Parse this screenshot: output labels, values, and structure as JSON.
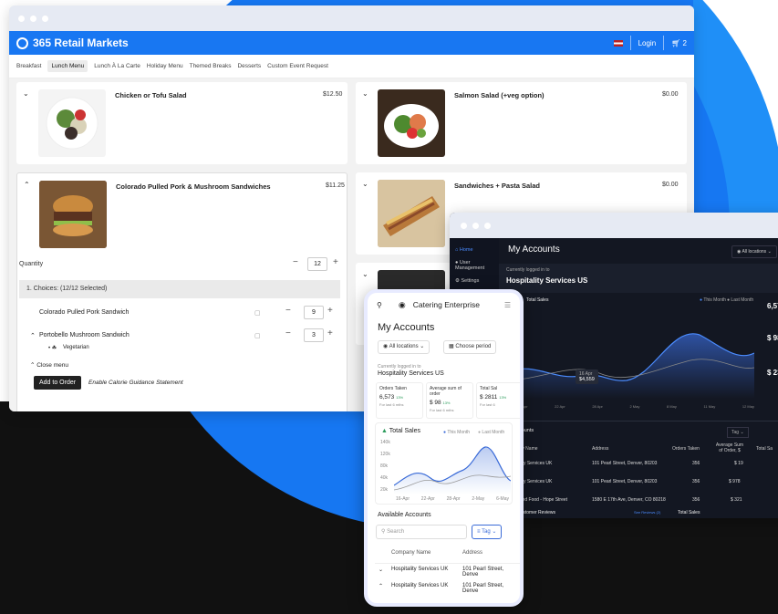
{
  "retail": {
    "brand": "365 Retail Markets",
    "login": "Login",
    "cart_count": "2",
    "categories": [
      "Breakfast",
      "Lunch Menu",
      "Lunch À La Carte",
      "Holiday Menu",
      "Themed Breaks",
      "Desserts",
      "Custom Event Request"
    ],
    "active_category": "Lunch Menu",
    "items": [
      {
        "name": "Chicken or Tofu Salad",
        "price": "$12.50"
      },
      {
        "name": "Salmon Salad (+veg option)",
        "price": "$0.00"
      },
      {
        "name": "Colorado Pulled Pork & Mushroom Sandwiches",
        "price": "$11.25"
      },
      {
        "name": "Sandwiches + Pasta Salad",
        "price": "$0.00"
      }
    ],
    "quantity_label": "Quantity",
    "quantity_value": "12",
    "choices_header": "1. Choices:  (12/12 Selected)",
    "choices": [
      {
        "name": "Colorado Pulled Pork Sandwich",
        "qty": "9"
      },
      {
        "name": "Portobello Mushroom Sandwich",
        "qty": "3"
      }
    ],
    "vegetarian": "Vegetarian",
    "close_menu": "Close menu",
    "add_to_order": "Add to Order",
    "calorie": "Enable Calorie Guidance Statement"
  },
  "dashboard": {
    "title": "My Accounts",
    "nav": [
      "Home",
      "User Management",
      "Settings"
    ],
    "locations": "All locations",
    "logged_in_label": "Currently logged in to",
    "account": "Hospitality Services US",
    "total_sales": "Total Sales",
    "legend": [
      "This Month",
      "Last Month"
    ],
    "tooltip_date": "16 Apr",
    "tooltip_value": "$4,559",
    "x_ticks": [
      "16 Apr",
      "22 Apr",
      "28 Apr",
      "2 May",
      "8 May",
      "11 May",
      "12 May"
    ],
    "side_values": [
      "6,57",
      "$ 98",
      "$ 23"
    ],
    "accounts_title": "le Accounts",
    "tag": "Tag",
    "columns": [
      "ompany Name",
      "Address",
      "Orders Taken",
      "Average Sum of Order, $",
      "Total Sa"
    ],
    "rows": [
      {
        "name": "ospitality Services UK",
        "address": "101 Pearl Street, Denver, 80203",
        "orders": "356",
        "avg": "$ 19"
      },
      {
        "name": "ospitality Services UK",
        "address": "101 Pearl Street, Denver, 80203",
        "orders": "356",
        "avg": "$ 978"
      },
      {
        "name": "ssociated Food - Hope Street",
        "address": "1580 E 17th Ave, Denver, CO 80218",
        "orders": "356",
        "avg": "$ 321"
      }
    ],
    "reviews": "Customer Reviews",
    "see_all": "See Reviews (2)",
    "total_sales_2": "Total Sales"
  },
  "mobile": {
    "app": "Catering Enterprise",
    "title": "My Accounts",
    "locations": "All locations",
    "period": "Choose period",
    "logged_in_label": "Currently logged in to",
    "account": "Hospitality Services US",
    "stats": [
      {
        "label": "Orders Taken",
        "value": "6,573",
        "delta": "13%",
        "sub": "For last 6 mths"
      },
      {
        "label": "Average sum of order",
        "value": "$ 98",
        "delta": "13%",
        "sub": "For last 6 mths"
      },
      {
        "label": "Total Sal",
        "value": "$ 2811",
        "delta": "13%",
        "sub": "For last 6"
      }
    ],
    "total_sales": "Total Sales",
    "legend": [
      "This Month",
      "Last Month"
    ],
    "y_ticks": [
      "140k",
      "120k",
      "80k",
      "40k",
      "20k"
    ],
    "x_ticks": [
      "16-Apr",
      "22-Apr",
      "28-Apr",
      "2-May",
      "6-May"
    ],
    "available": "Available Accounts",
    "search": "Search",
    "tag": "Tag",
    "col_company": "Company Name",
    "col_address": "Address",
    "rows": [
      {
        "name": "Hospitality Services UK",
        "address": "101 Pearl Street, Denve"
      },
      {
        "name": "Hospitality Services UK",
        "address": "101 Pearl Street, Denve"
      }
    ]
  }
}
